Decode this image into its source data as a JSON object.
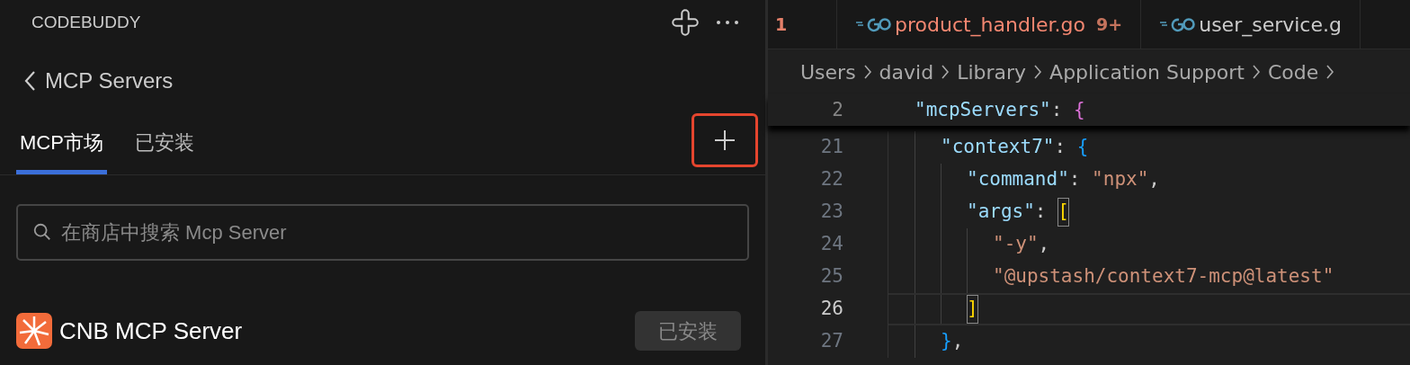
{
  "sidebar": {
    "title": "CODEBUDDY",
    "back_label": "MCP Servers",
    "tabs": [
      {
        "label": "MCP市场",
        "selected": true
      },
      {
        "label": "已安装",
        "selected": false
      }
    ],
    "search": {
      "placeholder": "在商店中搜索 Mcp Server"
    },
    "servers": [
      {
        "name": "CNB MCP Server",
        "action": "已安装",
        "installed": true
      }
    ]
  },
  "editor": {
    "group_number": "1",
    "tabs": [
      {
        "label": "product_handler.go",
        "badge": "9+",
        "has_errors": true
      },
      {
        "label": "user_service.g",
        "has_errors": false
      }
    ],
    "breadcrumb": [
      "Users",
      "david",
      "Library",
      "Application Support",
      "Code"
    ],
    "sticky_line": {
      "number": "2",
      "current": false,
      "tokens": [
        {
          "kind": "key",
          "text": "\"mcpServers\""
        },
        {
          "kind": "punct",
          "text": ": "
        },
        {
          "kind": "brace_outer",
          "text": "{"
        }
      ],
      "children": [
        {
          "number": "21",
          "current": false,
          "tokens": [
            {
              "kind": "key",
              "text": "\"context7\""
            },
            {
              "kind": "punct",
              "text": ": "
            },
            {
              "kind": "brace_inner",
              "text": "{"
            }
          ],
          "children": [
            {
              "number": "22",
              "current": false,
              "tokens": [
                {
                  "kind": "key",
                  "text": "\"command\""
                },
                {
                  "kind": "punct",
                  "text": ": "
                },
                {
                  "kind": "string",
                  "text": "\"npx\""
                },
                {
                  "kind": "punct",
                  "text": ","
                }
              ]
            },
            {
              "number": "23",
              "current": false,
              "tokens": [
                {
                  "kind": "key",
                  "text": "\"args\""
                },
                {
                  "kind": "punct",
                  "text": ": "
                },
                {
                  "kind": "bracket_matched",
                  "text": "["
                }
              ],
              "children": [
                {
                  "number": "24",
                  "current": false,
                  "tokens": [
                    {
                      "kind": "string",
                      "text": "\"-y\""
                    },
                    {
                      "kind": "punct",
                      "text": ","
                    }
                  ]
                },
                {
                  "number": "25",
                  "current": false,
                  "tokens": [
                    {
                      "kind": "string",
                      "text": "\"@upstash/context7-mcp@latest\""
                    }
                  ]
                }
              ]
            },
            {
              "number": "26",
              "current": true,
              "tokens": [
                {
                  "kind": "bracket_matched",
                  "text": "]"
                }
              ]
            }
          ]
        },
        {
          "number": "27",
          "current": false,
          "tokens": [
            {
              "kind": "brace_inner",
              "text": "}"
            },
            {
              "kind": "punct",
              "text": ","
            }
          ]
        }
      ]
    }
  }
}
